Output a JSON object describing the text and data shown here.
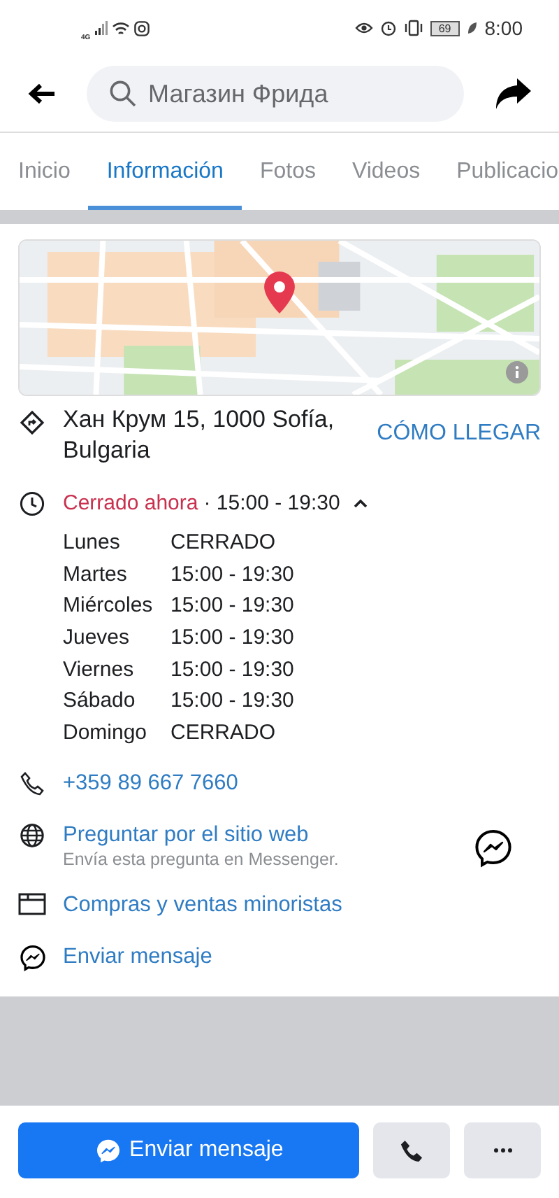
{
  "status_bar": {
    "network": "4G",
    "battery": "69",
    "time": "8:00"
  },
  "search": {
    "value": "Магазин Фрида"
  },
  "tabs": [
    {
      "label": "Inicio",
      "selected": false
    },
    {
      "label": "Información",
      "selected": true
    },
    {
      "label": "Fotos",
      "selected": false
    },
    {
      "label": "Videos",
      "selected": false
    },
    {
      "label": "Publicacio",
      "selected": false
    }
  ],
  "address": {
    "text": "Хан Крум 15, 1000 Sofía, Bulgaria",
    "action": "CÓMO LLEGAR"
  },
  "hours": {
    "status": "Cerrado ahora",
    "range": "· 15:00 - 19:30",
    "expanded": true,
    "days": [
      {
        "day": "Lunes",
        "hours": "CERRADO"
      },
      {
        "day": "Martes",
        "hours": "15:00 - 19:30"
      },
      {
        "day": "Miércoles",
        "hours": "15:00 - 19:30"
      },
      {
        "day": "Jueves",
        "hours": "15:00 - 19:30"
      },
      {
        "day": "Viernes",
        "hours": "15:00 - 19:30"
      },
      {
        "day": "Sábado",
        "hours": "15:00 - 19:30"
      },
      {
        "day": "Domingo",
        "hours": "CERRADO"
      }
    ]
  },
  "phone": "+359 89 667 7660",
  "website_prompt": {
    "title": "Preguntar por el sitio web",
    "subtitle": "Envía esta pregunta en Messenger."
  },
  "category": "Compras y ventas minoristas",
  "message_link": "Enviar mensaje",
  "actions": {
    "primary": "Enviar mensaje"
  }
}
